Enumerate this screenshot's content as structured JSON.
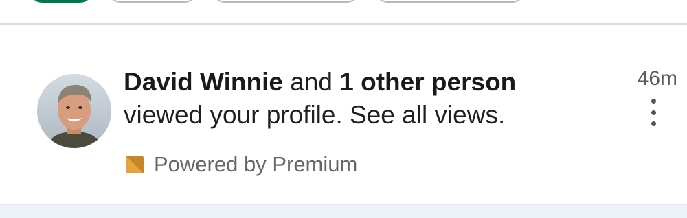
{
  "chips": {
    "items": [
      "",
      "",
      "",
      ""
    ],
    "active_color": "#01754f"
  },
  "notification": {
    "avatar": {
      "icon": "person-avatar"
    },
    "actor_name": "David Winnie",
    "conjunction": " and ",
    "others": "1 other person",
    "message": "viewed your profile. See all views.",
    "footer_icon": "premium-icon",
    "footer_text": "Powered by Premium",
    "time": "46m",
    "more_icon": "more-vertical-icon"
  },
  "colors": {
    "premium_gold": "#e7a33e",
    "next_item_bg": "#eef3fa"
  }
}
